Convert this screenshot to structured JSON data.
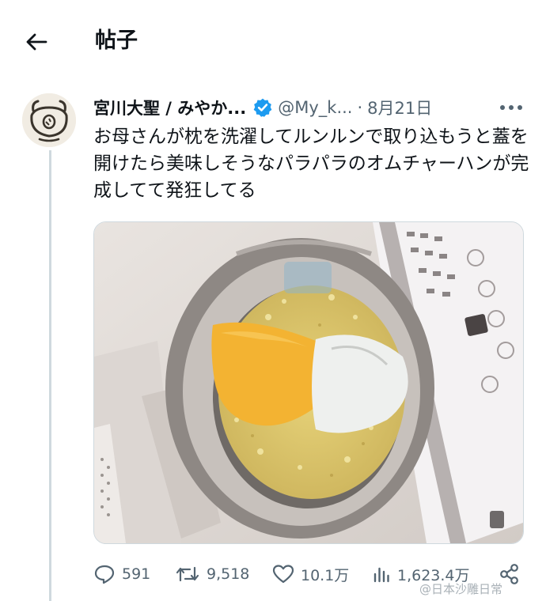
{
  "header": {
    "title": "帖子",
    "back_icon": "arrow-left-icon"
  },
  "tweet": {
    "author_name": "宮川大聖 / みやか...",
    "handle": "@My_k...",
    "separator": "·",
    "date": "8月21日",
    "verified": true,
    "text": "お母さんが枕を洗濯してルンルンで取り込もうと蓋を開けたら美味しそうなパラパラのオムチャーハンが完成してて発狂してる",
    "more_icon": "more-horizontal-icon"
  },
  "metrics": {
    "replies": "591",
    "retweets": "9,518",
    "likes": "10.1万",
    "views": "1,623.4万"
  },
  "watermark": "@日本沙雕日常",
  "colors": {
    "accent": "#1d9bf0",
    "text": "#0f1419",
    "muted": "#536471"
  }
}
